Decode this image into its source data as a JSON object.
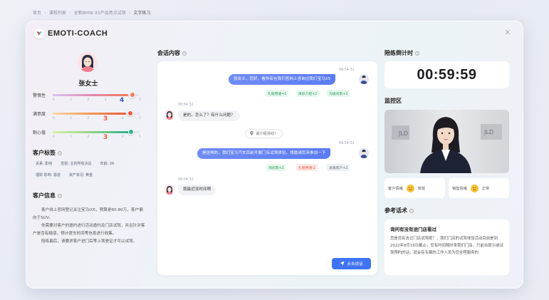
{
  "breadcrumb": [
    "首页",
    "课程列表",
    "全新BMW X5产品亮点试驾",
    "文字练习"
  ],
  "app": {
    "logo_text": "EMOTI-COACH"
  },
  "customer": {
    "name": "张女士",
    "metrics": [
      {
        "label": "警惕性",
        "value": "4",
        "level": 4,
        "max": 5,
        "color": "#3b56c7"
      },
      {
        "label": "满意度",
        "value": "3",
        "level": 3,
        "max": 5,
        "color": "#e8573a"
      },
      {
        "label": "耐心值",
        "value": "3",
        "level": 3,
        "max": 5,
        "color": "#e8573a"
      }
    ],
    "ticks": [
      "0",
      "1",
      "2",
      "3",
      "4",
      "5"
    ],
    "tags_title": "客户标签",
    "tags": [
      "关系: 影响",
      "性别: 主的所有决议",
      "年龄: 26",
      "理财 影响: 激进",
      "资产状况: 黄金"
    ],
    "info_title": "客户信息",
    "info": [
      "客户线上官网登记关注宝马iX5，预算是60-80万，客户偏向于SUV。",
      "你需要对客户的邀约进行活动邀约及门店试驾，并且针对客户是否有疑惑，预计提车时间等信息进行收集。",
      "陪练最后，请要求客户进门后等上驾驶证才可以试驾。"
    ]
  },
  "chat": {
    "title": "会话内容",
    "messages": [
      {
        "time": "09:54:32",
        "side": "right",
        "text": "张女士，您好，看你有在我们官网上咨询过我们宝马X5",
        "chips": [
          {
            "text": "礼貌用语+1",
            "tone": "green"
          },
          {
            "text": "目标介绍+2",
            "tone": "green"
          },
          {
            "text": "沟通背景+2",
            "tone": "green"
          }
        ]
      },
      {
        "time": "09:54:32",
        "side": "left",
        "text": "是的，怎么了？有什么问题？",
        "chips": []
      },
      {
        "time": "09:54:32",
        "side": "right",
        "text": "是这样的，我们宝马汽车目前开展门店试驾体验，想邀请您来参加一下",
        "chips": [
          {
            "text": "询问需+2",
            "tone": "green"
          },
          {
            "text": "礼貌用语-2",
            "tone": "red"
          },
          {
            "text": "发邀客户+2",
            "tone": "gray"
          }
        ]
      },
      {
        "time": "09:54:32",
        "side": "left",
        "text": "我最近没时间啊",
        "chips": []
      }
    ],
    "center_note": "请介绍活动！",
    "send_button": "点击说话"
  },
  "timer": {
    "title": "陪练倒计时",
    "value": "00:59:59"
  },
  "monitor": {
    "title": "监控区",
    "customer_emotion_label": "客户情绪",
    "customer_emotion_value": "愉悦",
    "sales_emotion_label": "销售情绪",
    "sales_emotion_value": "正常"
  },
  "reference": {
    "title": "参考话术",
    "heading": "询问有没有进门店看过",
    "body": "您是否有去过门店试驾呢？，我们门店的试驾体验活动目前是到2022年8月16日截止，您有时间随时来我们门店，只前台提示或试驾预约的话，就会有专属的工作人员为您全程服务的"
  },
  "colors": {
    "primary": "#3f73f2",
    "bubble": "#5a7bf2",
    "danger": "#e8573a"
  }
}
